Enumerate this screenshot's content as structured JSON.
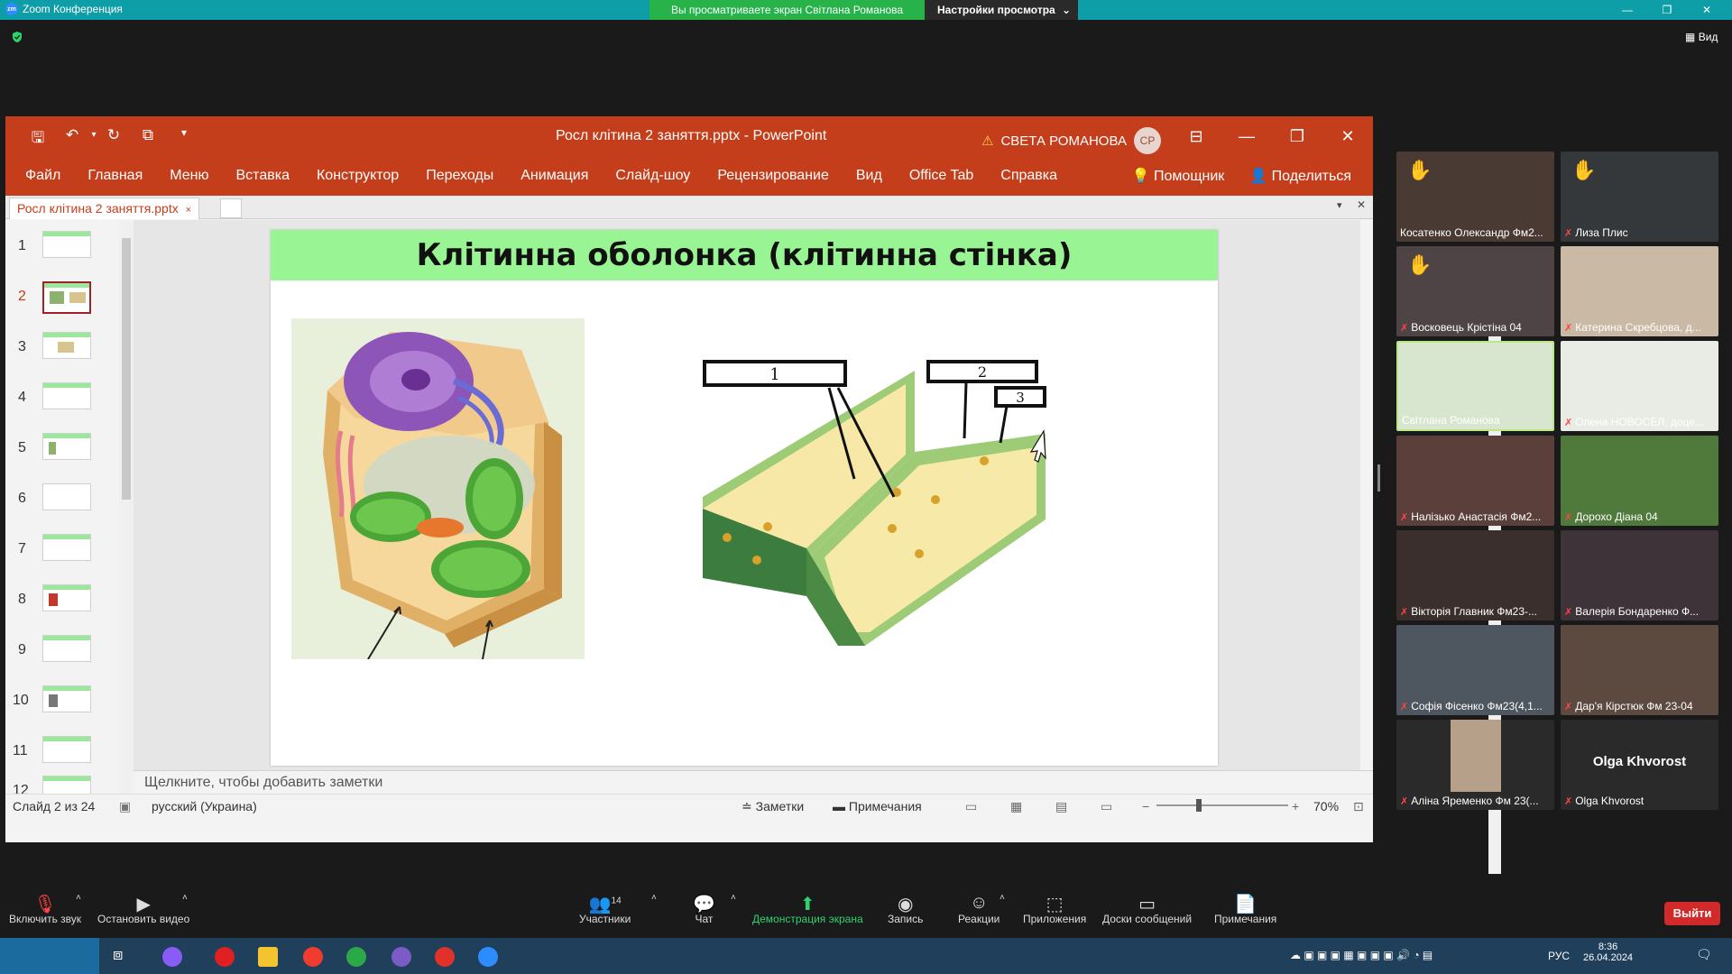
{
  "zoom": {
    "app_title": "Zoom Конференция",
    "share_banner": "Вы просматриваете экран Світлана Романова",
    "view_options": "Настройки просмотра",
    "view_button": "Вид",
    "toolbar": {
      "mute": "Включить звук",
      "video": "Остановить видео",
      "participants": "Участники",
      "participants_count": "14",
      "chat": "Чат",
      "share": "Демонстрация экрана",
      "record": "Запись",
      "reactions": "Реакции",
      "apps": "Приложения",
      "whiteboards": "Доски сообщений",
      "notes": "Примечания",
      "leave": "Выйти"
    }
  },
  "ppt": {
    "doc_title": "Росл клітина 2 заняття.pptx  -  PowerPoint",
    "user_name": "СВЕТА РОМАНОВА",
    "user_initials": "СР",
    "ribbon_tabs": [
      "Файл",
      "Главная",
      "Меню",
      "Вставка",
      "Конструктор",
      "Переходы",
      "Анимация",
      "Слайд-шоу",
      "Рецензирование",
      "Вид",
      "Office Tab",
      "Справка"
    ],
    "assistant": "Помощник",
    "share": "Поделиться",
    "doc_tab": "Росл клітина 2 заняття.pptx",
    "slide_numbers": [
      "1",
      "2",
      "3",
      "4",
      "5",
      "6",
      "7",
      "8",
      "9",
      "10",
      "11",
      "12"
    ],
    "slide_title": "Клітинна оболонка (клітинна стінка)",
    "wall_labels": [
      "1",
      "2",
      "3"
    ],
    "notes_placeholder": "Щелкните, чтобы добавить заметки",
    "status": {
      "slide_info": "Слайд 2 из 24",
      "language": "русский (Украина)",
      "notes": "Заметки",
      "comments": "Примечания",
      "zoom": "70%"
    }
  },
  "participants": [
    {
      "name": "Косатенко Олександр Фм2...",
      "hand": true,
      "muted": false
    },
    {
      "name": "Лиза Плис",
      "hand": true,
      "muted": true
    },
    {
      "name": "Восковець Крістіна 04",
      "hand": true,
      "muted": true
    },
    {
      "name": "Катерина Скребцова, д...",
      "hand": false,
      "muted": true
    },
    {
      "name": "Світлана Романова",
      "hand": false,
      "muted": false
    },
    {
      "name": "Олена НОВОСЕЛ, доце...",
      "hand": false,
      "muted": true
    },
    {
      "name": "Налізько Анастасія Фм2...",
      "hand": false,
      "muted": true
    },
    {
      "name": "Дорохо Діана 04",
      "hand": false,
      "muted": true
    },
    {
      "name": "Вікторія Главник Фм23-...",
      "hand": false,
      "muted": true
    },
    {
      "name": "Валерія Бондаренко Ф...",
      "hand": false,
      "muted": true
    },
    {
      "name": "Софія Фісенко Фм23(4,1...",
      "hand": false,
      "muted": true
    },
    {
      "name": "Дар'я Кірстюк Фм 23-04",
      "hand": false,
      "muted": true
    },
    {
      "name": "Аліна Яременко Фм 23(...",
      "hand": false,
      "muted": true
    },
    {
      "name": "Olga Khvorost",
      "hand": false,
      "muted": true,
      "display_name": "Olga Khvorost"
    }
  ],
  "taskbar": {
    "lang": "РУС",
    "time": "8:36",
    "date": "26.04.2024"
  }
}
